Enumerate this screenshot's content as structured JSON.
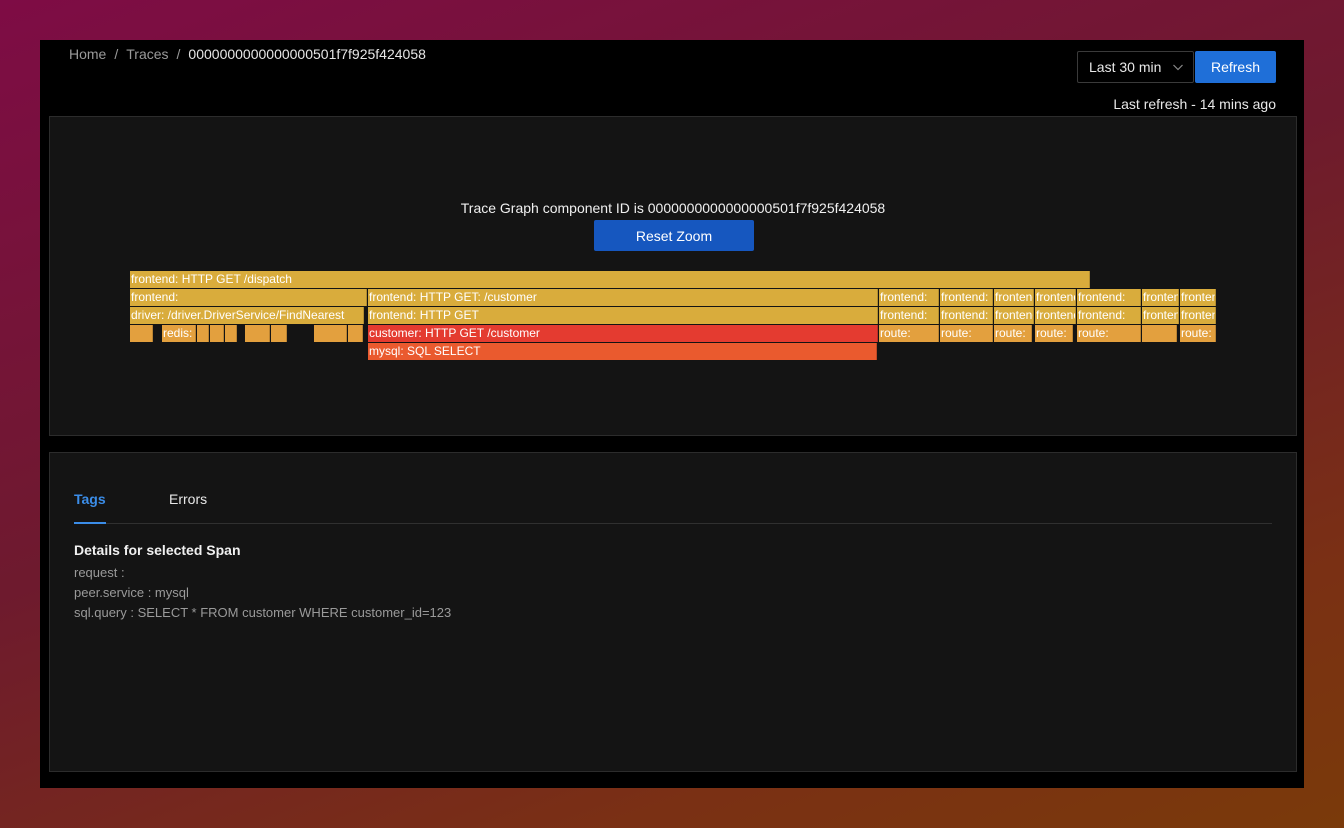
{
  "breadcrumb": {
    "home": "Home",
    "traces": "Traces",
    "current": "0000000000000000501f7f925f424058",
    "separator": "/"
  },
  "time_range": {
    "selected": "Last 30 min",
    "icon": "chevron-down-icon"
  },
  "refresh_button": {
    "label": "Refresh"
  },
  "last_refresh": "Last refresh - 14 mins ago",
  "graph": {
    "title": "Trace Graph component ID is 0000000000000000501f7f925f424058",
    "reset_zoom": "Reset Zoom",
    "total_duration_fraction_of_view": 1.0,
    "spans": [
      {
        "label": "frontend: HTTP GET /dispatch",
        "depth": 0,
        "start": 0,
        "end": 0.884,
        "color": "#d9ac3c"
      },
      {
        "label": "frontend:",
        "depth": 1,
        "start": 0,
        "end": 0.219,
        "color": "#d9ac3c"
      },
      {
        "label": "frontend: HTTP GET: /customer",
        "depth": 1,
        "start": 0.219,
        "end": 0.689,
        "color": "#d9ac3c"
      },
      {
        "label": "frontend:",
        "depth": 1,
        "start": 0.689,
        "end": 0.745,
        "color": "#d9ac3c"
      },
      {
        "label": "frontend:",
        "depth": 1,
        "start": 0.745,
        "end": 0.795,
        "color": "#d9ac3c"
      },
      {
        "label": "frontend:",
        "depth": 1,
        "start": 0.795,
        "end": 0.833,
        "color": "#d9ac3c"
      },
      {
        "label": "frontend:",
        "depth": 1,
        "start": 0.833,
        "end": 0.871,
        "color": "#d9ac3c"
      },
      {
        "label": "frontend:",
        "depth": 1,
        "start": 0.871,
        "end": 0.931,
        "color": "#d9ac3c"
      },
      {
        "label": "frontend:",
        "depth": 1,
        "start": 0.931,
        "end": 0.966,
        "color": "#d9ac3c"
      },
      {
        "label": "frontend:",
        "depth": 1,
        "start": 0.966,
        "end": 1.0,
        "color": "#d9ac3c"
      },
      {
        "label": "driver: /driver.DriverService/FindNearest",
        "depth": 2,
        "start": 0,
        "end": 0.216,
        "color": "#d9ac3c"
      },
      {
        "label": "frontend: HTTP GET",
        "depth": 2,
        "start": 0.219,
        "end": 0.689,
        "color": "#d9ac3c"
      },
      {
        "label": "frontend:",
        "depth": 2,
        "start": 0.689,
        "end": 0.745,
        "color": "#d9ac3c"
      },
      {
        "label": "frontend:",
        "depth": 2,
        "start": 0.745,
        "end": 0.795,
        "color": "#d9ac3c"
      },
      {
        "label": "frontend:",
        "depth": 2,
        "start": 0.795,
        "end": 0.833,
        "color": "#d9ac3c"
      },
      {
        "label": "frontend:",
        "depth": 2,
        "start": 0.833,
        "end": 0.871,
        "color": "#d9ac3c"
      },
      {
        "label": "frontend:",
        "depth": 2,
        "start": 0.871,
        "end": 0.931,
        "color": "#d9ac3c"
      },
      {
        "label": "frontend:",
        "depth": 2,
        "start": 0.931,
        "end": 0.966,
        "color": "#d9ac3c"
      },
      {
        "label": "frontend:",
        "depth": 2,
        "start": 0.966,
        "end": 1.0,
        "color": "#d9ac3c"
      },
      {
        "label": "",
        "depth": 3,
        "start": 0,
        "end": 0.022,
        "color": "#e3a03e"
      },
      {
        "label": "redis:",
        "depth": 3,
        "start": 0.029,
        "end": 0.062,
        "color": "#e3a03e"
      },
      {
        "label": "",
        "depth": 3,
        "start": 0.062,
        "end": 0.074,
        "color": "#e3a03e"
      },
      {
        "label": "",
        "depth": 3,
        "start": 0.074,
        "end": 0.087,
        "color": "#e3a03e"
      },
      {
        "label": "",
        "depth": 3,
        "start": 0.087,
        "end": 0.099,
        "color": "#e3a03e"
      },
      {
        "label": "",
        "depth": 3,
        "start": 0.106,
        "end": 0.13,
        "color": "#e3a03e"
      },
      {
        "label": "",
        "depth": 3,
        "start": 0.13,
        "end": 0.145,
        "color": "#e3a03e"
      },
      {
        "label": "",
        "depth": 3,
        "start": 0.169,
        "end": 0.201,
        "color": "#e3a03e"
      },
      {
        "label": "",
        "depth": 3,
        "start": 0.201,
        "end": 0.215,
        "color": "#e3a03e"
      },
      {
        "label": "customer: HTTP GET /customer",
        "depth": 3,
        "start": 0.219,
        "end": 0.689,
        "color": "#e43b30"
      },
      {
        "label": "route:",
        "depth": 3,
        "start": 0.689,
        "end": 0.745,
        "color": "#e3a03e"
      },
      {
        "label": "route:",
        "depth": 3,
        "start": 0.745,
        "end": 0.795,
        "color": "#e3a03e"
      },
      {
        "label": "route:",
        "depth": 3,
        "start": 0.795,
        "end": 0.831,
        "color": "#e3a03e"
      },
      {
        "label": "route:",
        "depth": 3,
        "start": 0.833,
        "end": 0.868,
        "color": "#e3a03e"
      },
      {
        "label": "route:",
        "depth": 3,
        "start": 0.871,
        "end": 0.931,
        "color": "#e3a03e"
      },
      {
        "label": "",
        "depth": 3,
        "start": 0.931,
        "end": 0.964,
        "color": "#e3a03e"
      },
      {
        "label": "route:",
        "depth": 3,
        "start": 0.966,
        "end": 1.0,
        "color": "#e3a03e"
      },
      {
        "label": "mysql: SQL SELECT",
        "depth": 4,
        "start": 0.219,
        "end": 0.688,
        "color": "#ea5a2e"
      }
    ]
  },
  "details": {
    "tabs": [
      {
        "label": "Tags",
        "active": true
      },
      {
        "label": "Errors",
        "active": false
      }
    ],
    "heading": "Details for selected Span",
    "tags": [
      {
        "text": "request :"
      },
      {
        "text": "peer.service : mysql"
      },
      {
        "text": "sql.query : SELECT * FROM customer WHERE customer_id=123"
      }
    ]
  }
}
